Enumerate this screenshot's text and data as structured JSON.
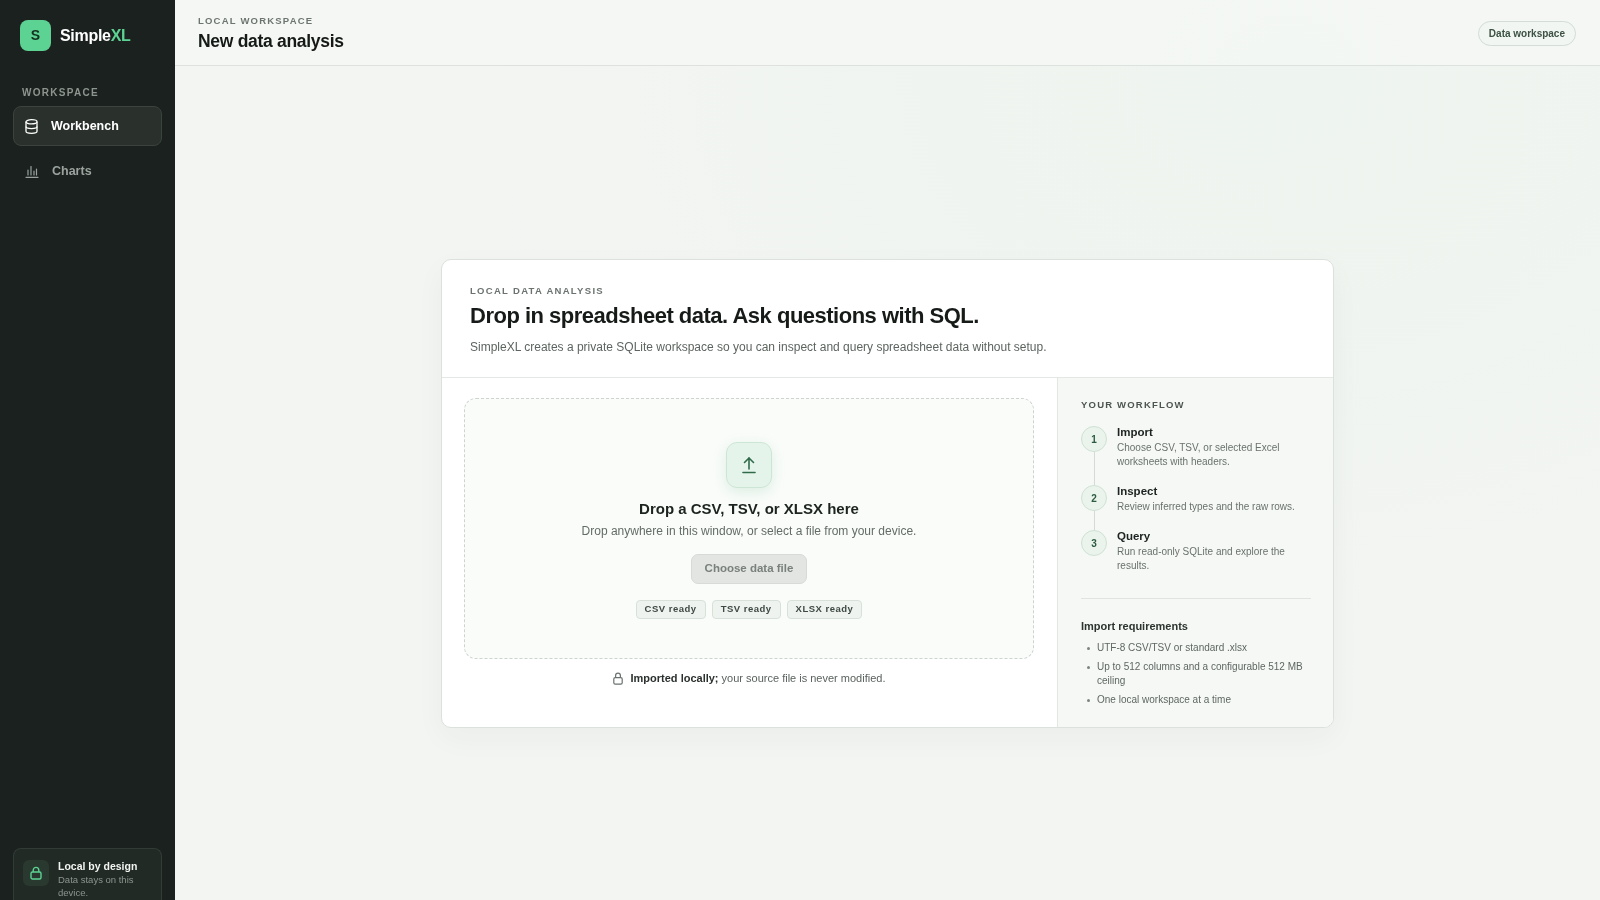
{
  "sidebar": {
    "brand": {
      "mark": "S",
      "name": "Simple",
      "accent": "XL"
    },
    "section_label": "WORKSPACE",
    "items": [
      {
        "label": "Workbench",
        "selected": true
      },
      {
        "label": "Charts",
        "selected": false
      }
    ],
    "footer": {
      "title": "Local by design",
      "text": "Data stays on this device."
    }
  },
  "header": {
    "eyebrow": "LOCAL WORKSPACE",
    "title": "New data analysis",
    "badge": "Data workspace"
  },
  "intro_card": {
    "eyebrow": "LOCAL DATA ANALYSIS",
    "title": "Drop in spreadsheet data. Ask questions with SQL.",
    "subtitle": "SimpleXL creates a private SQLite workspace so you can inspect and query spreadsheet data without setup.",
    "dropzone": {
      "title": "Drop a CSV, TSV, or XLSX here",
      "text": "Drop anywhere in this window, or select a file from your device.",
      "button": {
        "label": "Choose data file",
        "disabled": true
      },
      "formats": [
        "CSV ready",
        "TSV ready",
        "XLSX ready"
      ]
    },
    "note": "**Imported locally;** your source file is never modified.",
    "workflow": {
      "title": "YOUR WORKFLOW",
      "steps": [
        {
          "number": "1",
          "title": "Import",
          "text": "Choose CSV, TSV, or selected Excel worksheets with headers."
        },
        {
          "number": "2",
          "title": "Inspect",
          "text": "Review inferred types and the raw rows."
        },
        {
          "number": "3",
          "title": "Query",
          "text": "Run read-only SQLite and explore the results."
        }
      ]
    },
    "requirements": {
      "title": "Import requirements",
      "items": [
        "UTF-8 CSV/TSV or standard .xlsx",
        "Up to 512 columns and a configurable 512 MB ceiling",
        "One local workspace at a time"
      ]
    }
  }
}
